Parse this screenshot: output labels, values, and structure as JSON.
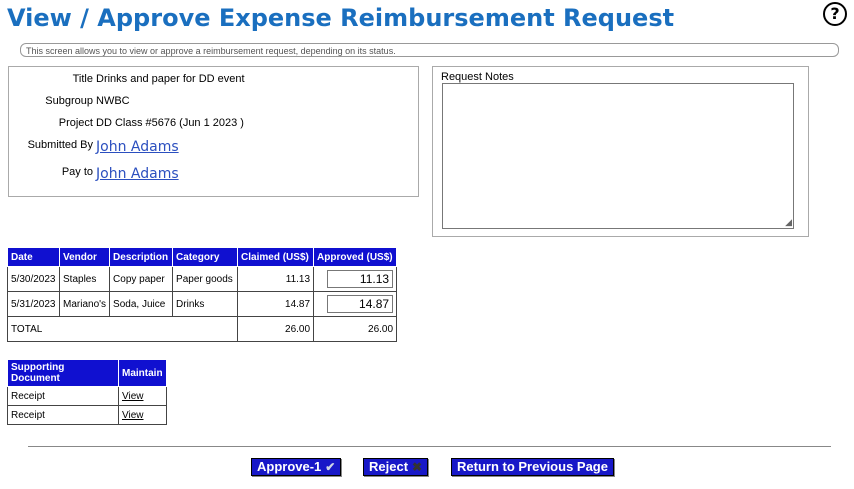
{
  "page": {
    "title": "View / Approve Expense Reimbursement Request",
    "help_glyph": "?",
    "info": "This screen allows you to view or approve a reimbursement request, depending on its status."
  },
  "request": {
    "title_label": "Title",
    "title_value": "Drinks and paper for DD event",
    "subgroup_label": "Subgroup",
    "subgroup_value": "NWBC",
    "project_label": "Project",
    "project_value": "DD Class #5676 (Jun 1 2023 )",
    "submitted_label": "Submitted By",
    "submitted_value": "John Adams",
    "payto_label": "Pay to",
    "payto_value": "John Adams"
  },
  "notes": {
    "label": "Request Notes",
    "value": ""
  },
  "expenses": {
    "headers": [
      "Date",
      "Vendor",
      "Description",
      "Category",
      "Claimed (US$)",
      "Approved (US$)"
    ],
    "rows": [
      {
        "date": "5/30/2023",
        "vendor": "Staples",
        "description": "Copy paper",
        "category": "Paper goods",
        "claimed": "11.13",
        "approved": "11.13"
      },
      {
        "date": "5/31/2023",
        "vendor": "Mariano's",
        "description": "Soda, Juice",
        "category": "Drinks",
        "claimed": "14.87",
        "approved": "14.87"
      }
    ],
    "total_label": "TOTAL",
    "total_claimed": "26.00",
    "total_approved": "26.00"
  },
  "documents": {
    "headers": [
      "Supporting Document",
      "Maintain"
    ],
    "rows": [
      {
        "name": "Receipt",
        "action": "View"
      },
      {
        "name": "Receipt",
        "action": "View"
      }
    ]
  },
  "buttons": {
    "approve": "Approve-1",
    "approve_icon": "checkmark-icon",
    "reject": "Reject",
    "reject_icon": "x-icon",
    "return": "Return to Previous Page"
  }
}
